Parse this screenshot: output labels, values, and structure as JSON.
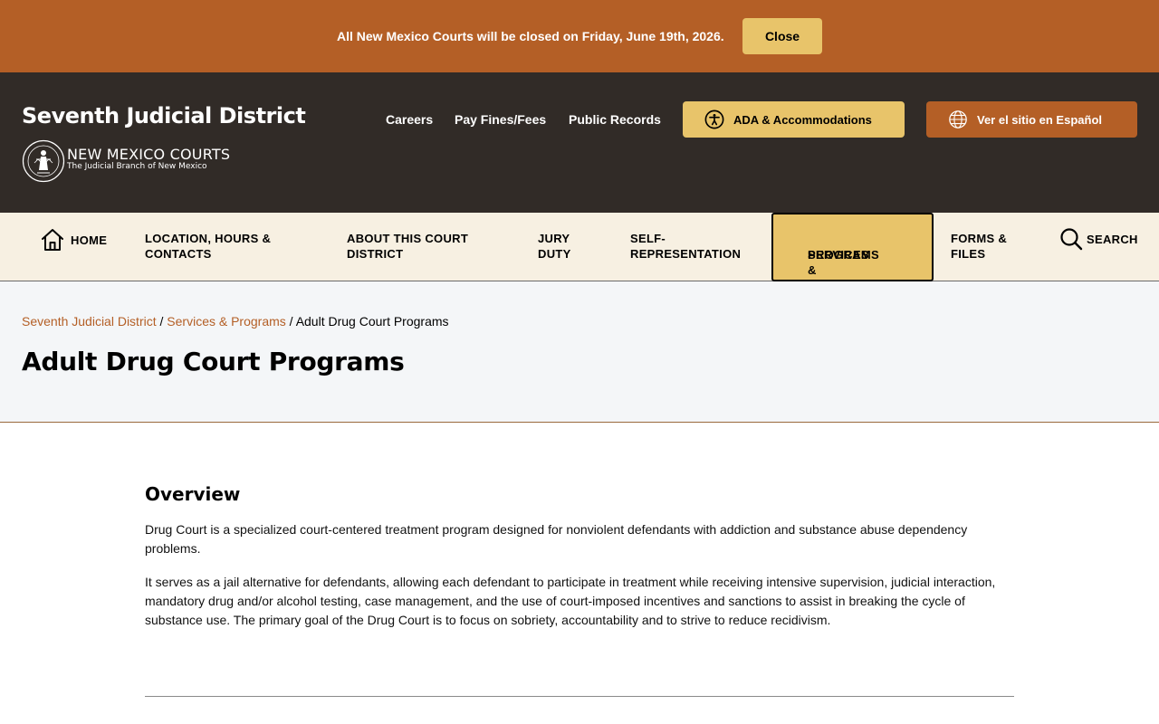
{
  "alert": {
    "message": "All New Mexico Courts will be closed on Friday, June 19th, 2026.",
    "close_label": "Close"
  },
  "header": {
    "site_title": "Seventh Judicial District",
    "logo_main": "NEW MEXICO COURTS",
    "logo_sub": "The Judicial Branch of New Mexico",
    "links": {
      "careers": "Careers",
      "pay_fines": "Pay Fines/Fees",
      "public_records": "Public Records"
    },
    "ada_label": "ADA & Accommodations",
    "spanish_label": "Ver el sitio en Español"
  },
  "nav": {
    "home": "HOME",
    "location_1": "LOCATION, HOURS &",
    "location_2": "CONTACTS",
    "about_1": "ABOUT THIS COURT",
    "about_2": "DISTRICT",
    "jury_1": "JURY",
    "jury_2": "DUTY",
    "self_1": "SELF-",
    "self_2": "REPRESENTATION",
    "services_1": "SERVICES &",
    "services_2": "PROGRAMS",
    "forms_1": "FORMS &",
    "forms_2": "FILES",
    "search": "SEARCH"
  },
  "breadcrumb": {
    "home": "Seventh Judicial District",
    "separator": "/",
    "section": "Services & Programs",
    "current": "Adult Drug Court Programs"
  },
  "page": {
    "title": "Adult Drug Court Programs",
    "overview_heading": "Overview",
    "paragraph_1": "Drug Court is a specialized court-centered treatment program designed for nonviolent defendants with addiction and substance abuse dependency problems.",
    "paragraph_2": "It serves as a jail alternative for defendants, allowing each defendant to participate in treatment while receiving intensive supervision, judicial interaction, mandatory drug and/or alcohol testing, case management, and the use of court-imposed incentives and sanctions to assist in breaking the cycle of substance use. The primary goal of the Drug Court is to focus on sobriety, accountability and to strive to reduce recidivism."
  },
  "icons": {
    "ada": "accessibility-icon",
    "language": "globe-icon",
    "home": "home-icon",
    "search": "search-icon",
    "seal": "court-seal-icon"
  },
  "colors": {
    "rust": "#b45f26",
    "gold": "#e8c46a",
    "dark": "#312b27",
    "cream": "#f7f0e2"
  }
}
